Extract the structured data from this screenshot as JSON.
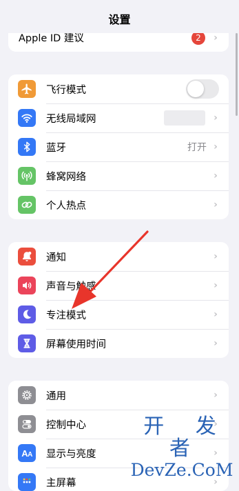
{
  "nav": {
    "title": "设置"
  },
  "apple_id": {
    "label": "Apple ID 建议",
    "badge": "2"
  },
  "connectivity": [
    {
      "label": "飞行模式",
      "icon": "airplane-icon",
      "color": "#f09a37",
      "accessory": "toggle",
      "toggle_on": false
    },
    {
      "label": "无线局域网",
      "icon": "wifi-icon",
      "color": "#3478f6",
      "accessory": "blurred-value"
    },
    {
      "label": "蓝牙",
      "icon": "bluetooth-icon",
      "color": "#3478f6",
      "value": "打开"
    },
    {
      "label": "蜂窝网络",
      "icon": "antenna-icon",
      "color": "#65c466"
    },
    {
      "label": "个人热点",
      "icon": "hotspot-link-icon",
      "color": "#65c466"
    }
  ],
  "notifications": [
    {
      "label": "通知",
      "icon": "bell-badge-icon",
      "color": "#eb4e3d"
    },
    {
      "label": "声音与触感",
      "icon": "speaker-icon",
      "color": "#eb445a"
    },
    {
      "label": "专注模式",
      "icon": "moon-icon",
      "color": "#5e5ce6"
    },
    {
      "label": "屏幕使用时间",
      "icon": "hourglass-icon",
      "color": "#5e5ce6"
    }
  ],
  "general": [
    {
      "label": "通用",
      "icon": "gear-icon",
      "color": "#8e8e93"
    },
    {
      "label": "控制中心",
      "icon": "switches-icon",
      "color": "#8e8e93"
    },
    {
      "label": "显示与亮度",
      "icon": "text-size-icon",
      "color": "#3478f6"
    },
    {
      "label": "主屏幕",
      "icon": "home-grid-icon",
      "color": "#3478f6"
    }
  ],
  "chevron": "›",
  "annotation": {
    "arrow_color": "#e8352b",
    "points_to": "专注模式"
  },
  "watermark": {
    "line1": "开 发 者",
    "line2": "DevZe.CoM"
  }
}
